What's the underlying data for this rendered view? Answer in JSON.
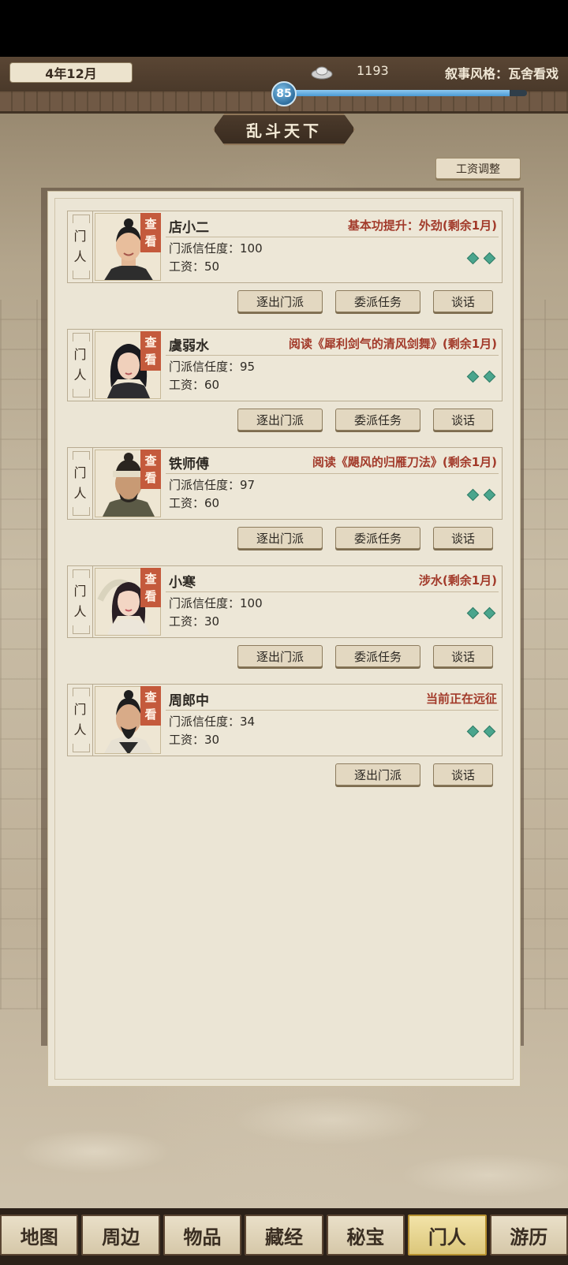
{
  "header": {
    "date": "4年12月",
    "silver_count": "1193",
    "narrative_style": "叙事风格：瓦舍看戏",
    "level": "85",
    "progress": 0.93
  },
  "page_title": "乱斗天下",
  "wage_adjust_label": "工资调整",
  "card_tag": [
    "门",
    "人"
  ],
  "view_tag": [
    "查",
    "看"
  ],
  "members": [
    {
      "name": "店小二",
      "status": "基本功提升：外劲(剩余1月)",
      "trust": "门派信任度：100",
      "wage": "工资：50",
      "buttons": [
        "逐出门派",
        "委派任务",
        "谈话"
      ]
    },
    {
      "name": "虞弱水",
      "status": "阅读《犀利剑气的清风剑舞》(剩余1月)",
      "trust": "门派信任度：95",
      "wage": "工资：60",
      "buttons": [
        "逐出门派",
        "委派任务",
        "谈话"
      ]
    },
    {
      "name": "铁师傅",
      "status": "阅读《飓风的归雁刀法》(剩余1月)",
      "trust": "门派信任度：97",
      "wage": "工资：60",
      "buttons": [
        "逐出门派",
        "委派任务",
        "谈话"
      ]
    },
    {
      "name": "小寒",
      "status": "涉水(剩余1月)",
      "trust": "门派信任度：100",
      "wage": "工资：30",
      "buttons": [
        "逐出门派",
        "委派任务",
        "谈话"
      ]
    },
    {
      "name": "周郎中",
      "status": "当前正在远征",
      "trust": "门派信任度：34",
      "wage": "工资：30",
      "buttons": [
        "逐出门派",
        "谈话"
      ]
    }
  ],
  "nav": {
    "tabs": [
      "地图",
      "周边",
      "物品",
      "藏经",
      "秘宝",
      "门人",
      "游历"
    ],
    "active": "门人"
  },
  "colors": {
    "status_red": "#a23a2a",
    "view_tag": "#c45a3c",
    "gem_green": "#4aa58d",
    "active_tab": "#dcc77b"
  }
}
